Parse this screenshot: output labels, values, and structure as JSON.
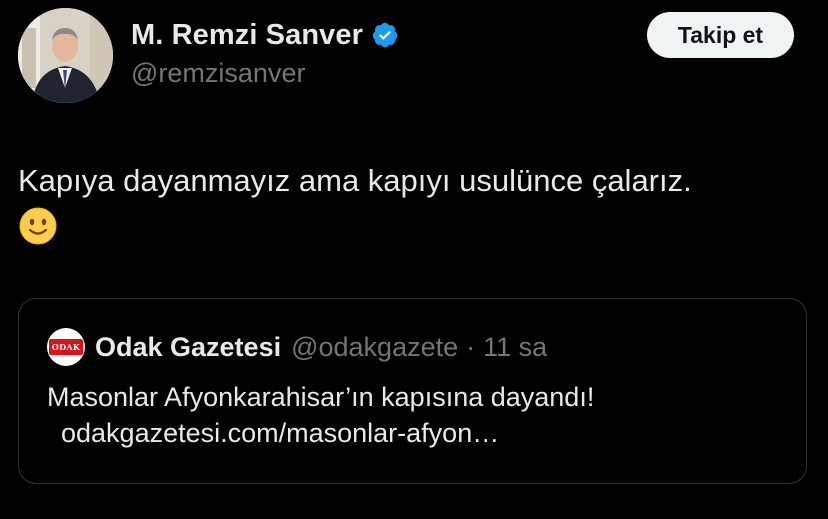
{
  "author": {
    "display_name": "M. Remzi Sanver",
    "handle": "@remzisanver",
    "verified_icon": "verified-badge-icon",
    "verified_color": "#1d9bf0"
  },
  "follow_button": {
    "label": "Takip et"
  },
  "tweet": {
    "text": "Kapıya dayanmayız ama kapıyı usulünce çalarız.",
    "emoji": "slightly-smiling-face-icon"
  },
  "quote": {
    "avatar_text": "ODAK",
    "display_name": "Odak Gazetesi",
    "handle": "@odakgazete",
    "separator": "·",
    "time": "11 sa",
    "text": "Masonlar Afyonkarahisar’ın kapısına dayandı!",
    "link": "odakgazetesi.com/masonlar-afyon…"
  },
  "colors": {
    "background": "#000000",
    "text_primary": "#e7e9ea",
    "text_secondary": "#71767b",
    "border": "#2f3336",
    "button_bg": "#eff3f4",
    "odak_red": "#d7141a"
  }
}
